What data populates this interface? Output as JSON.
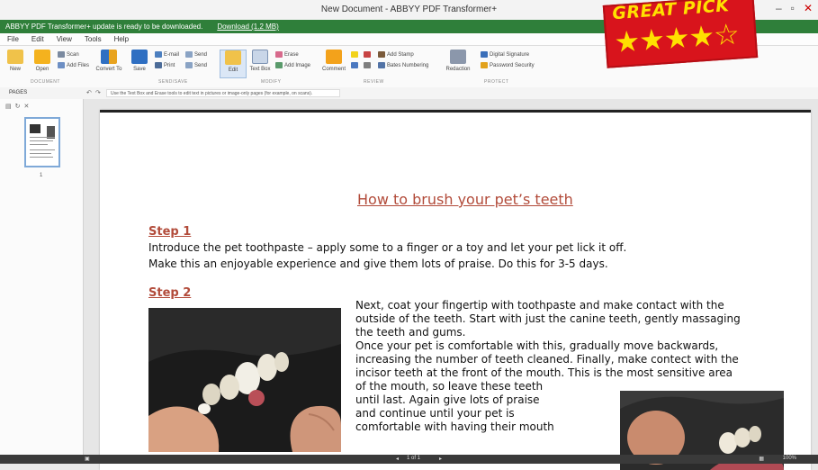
{
  "window": {
    "title": "New Document - ABBYY PDF Transformer+",
    "controls": [
      "–",
      "▫",
      "✕"
    ]
  },
  "notice": {
    "text": "ABBYY PDF Transformer+ update is ready to be downloaded.",
    "link": "Download (1.2 MB)"
  },
  "menu": [
    "File",
    "Edit",
    "View",
    "Tools",
    "Help"
  ],
  "ribbon": {
    "document": {
      "label": "DOCUMENT",
      "new": "New",
      "open": "Open",
      "scan": "Scan",
      "add_files": "Add Files"
    },
    "send_save": {
      "label": "SEND/SAVE",
      "convert_to": "Convert To",
      "save": "Save",
      "email": "E-mail",
      "send": "Send",
      "print": "Print",
      "send2": "Send"
    },
    "modify": {
      "label": "MODIFY",
      "edit": "Edit",
      "text_box": "Text Box",
      "erase": "Erase",
      "add_image": "Add Image"
    },
    "review": {
      "label": "REVIEW",
      "comment": "Comment",
      "add_stamp": "Add Stamp",
      "bates_numbering": "Bates Numbering"
    },
    "protect": {
      "label": "PROTECT",
      "redaction": "Redaction",
      "digital_signature": "Digital Signature",
      "password_security": "Password Security"
    }
  },
  "pages_panel": {
    "label": "PAGES",
    "hint": "Use the Text Box and Erase tools to edit text in pictures or image-only pages (for example, on scans).",
    "thumbnail_number": "1"
  },
  "document": {
    "title": "How to brush your pet’s teeth",
    "step1": {
      "heading": "Step 1",
      "lines": [
        "Introduce the pet toothpaste – apply some to a finger or a toy and let your pet lick it off.",
        "Make this an enjoyable experience and give them lots of praise. Do this for 3-5 days."
      ]
    },
    "step2": {
      "heading": "Step 2",
      "lines": [
        "Next, coat your fingertip with toothpaste and make contact with the",
        "outside of the teeth. Start with just the canine teeth, gently massaging",
        "the teeth and gums.",
        "Once your pet is comfortable with this, gradually move backwards,",
        "increasing the number of teeth cleaned. Finally, make contect with the",
        "incisor teeth at the front of the mouth. This is the most sensitive area",
        "of the mouth, so leave these teeth",
        "until last. Again give lots of praise",
        "and continue until your pet is",
        "comfortable with having their mouth"
      ]
    }
  },
  "statusbar": {
    "page": "1 of 1",
    "zoom": "100%"
  },
  "badge": {
    "title": "GREAT PICK",
    "stars": "★★★★☆",
    "rating": 4,
    "max_rating": 5
  },
  "colors": {
    "accent_green": "#2f7f3a",
    "heading_red": "#b24b3a",
    "badge_red": "#d8141c",
    "badge_yellow": "#ffe100"
  }
}
